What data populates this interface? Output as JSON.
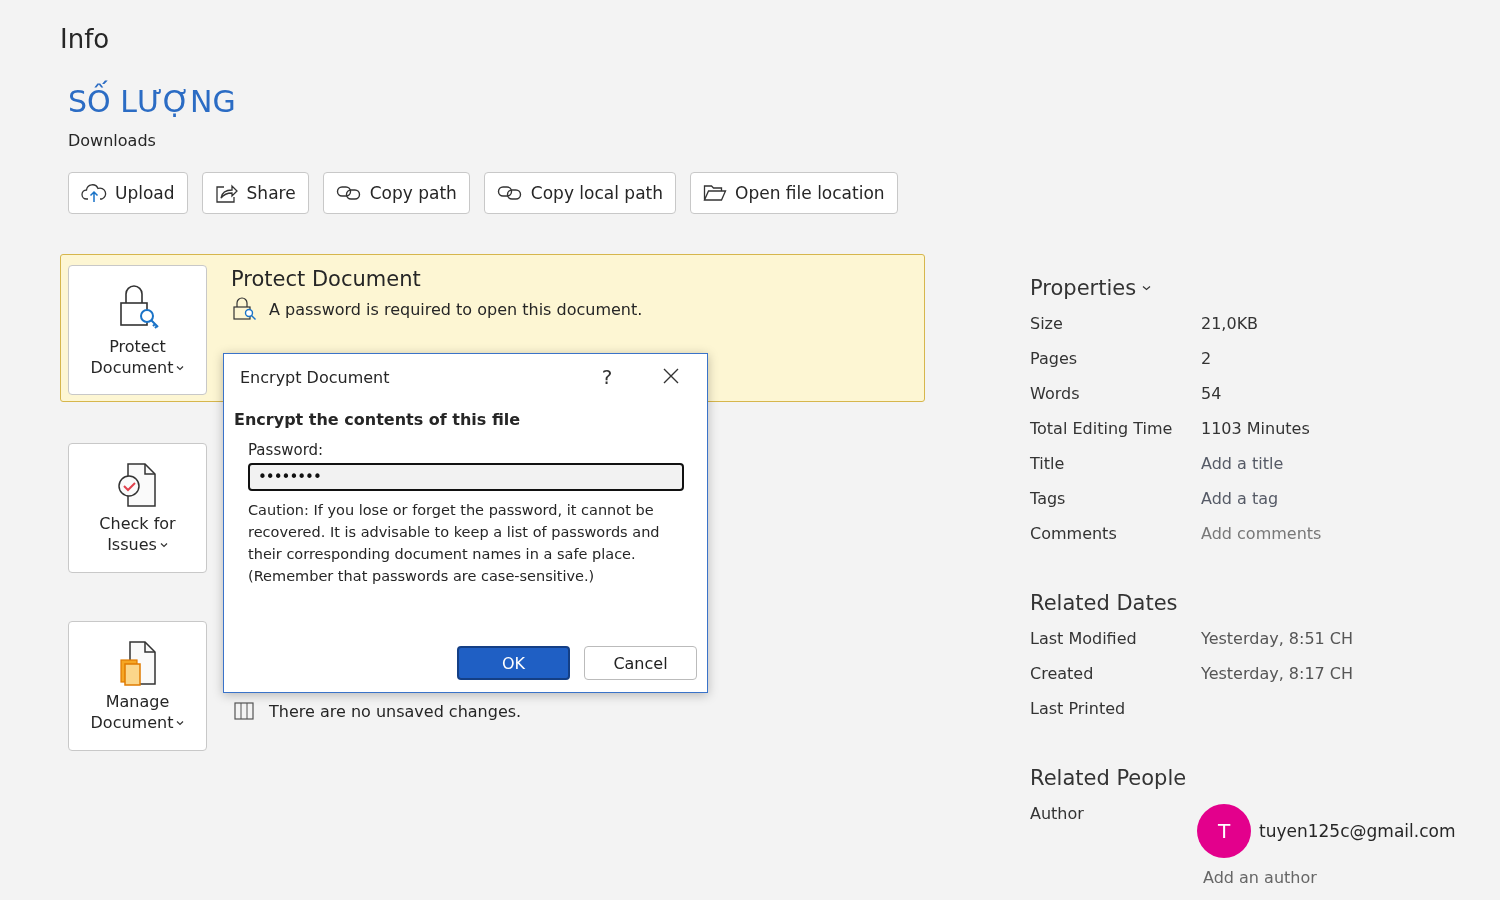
{
  "page": {
    "title": "Info"
  },
  "document": {
    "name": "SỐ LƯỢNG",
    "location": "Downloads"
  },
  "actions": [
    {
      "label": "Upload",
      "kind": "upload"
    },
    {
      "label": "Share",
      "kind": "share"
    },
    {
      "label": "Copy path",
      "kind": "link"
    },
    {
      "label": "Copy local path",
      "kind": "link"
    },
    {
      "label": "Open file location",
      "kind": "folder"
    }
  ],
  "sections": [
    {
      "kind": "protect",
      "highlighted": true,
      "button_lines": [
        "Protect",
        "Document"
      ],
      "title": "Protect Document",
      "details": [
        "A password is required to open this document."
      ]
    },
    {
      "kind": "check",
      "highlighted": false,
      "button_lines": [
        "Check for",
        "Issues"
      ]
    },
    {
      "kind": "manage",
      "highlighted": false,
      "button_lines": [
        "Manage",
        "Document"
      ],
      "details": [
        "There are no unsaved changes."
      ]
    }
  ],
  "dialog": {
    "title": "Encrypt Document",
    "help": "?",
    "heading": "Encrypt the contents of this file",
    "password_label": "Password:",
    "password_value": "••••••••",
    "caution": "Caution: If you lose or forget the password, it cannot be recovered. It is advisable to keep a list of passwords and their corresponding document names in a safe place.",
    "reminder": "(Remember that passwords are case-sensitive.)",
    "buttons": [
      {
        "label": "OK",
        "default": true
      },
      {
        "label": "Cancel",
        "default": false
      }
    ]
  },
  "properties": {
    "title": "Properties",
    "items": [
      {
        "label": "Size",
        "value": "21,0KB",
        "kind": "value"
      },
      {
        "label": "Pages",
        "value": "2",
        "kind": "value"
      },
      {
        "label": "Words",
        "value": "54",
        "kind": "value"
      },
      {
        "label": "Total Editing Time",
        "value": "1103 Minutes",
        "kind": "value"
      },
      {
        "label": "Title",
        "value": "Add a title",
        "kind": "editable"
      },
      {
        "label": "Tags",
        "value": "Add a tag",
        "kind": "editable"
      },
      {
        "label": "Comments",
        "placeholder": "Add comments",
        "kind": "placeholder"
      }
    ]
  },
  "related_dates": {
    "title": "Related Dates",
    "items": [
      {
        "label": "Last Modified",
        "value": "Yesterday, 8:51 CH"
      },
      {
        "label": "Created",
        "value": "Yesterday, 8:17 CH"
      },
      {
        "label": "Last Printed"
      }
    ]
  },
  "related_people": {
    "title": "Related People",
    "author_label": "Author",
    "author": {
      "initial": "T",
      "name": "tuyen125c@gmail.com",
      "color": "#e3008c"
    },
    "add_author": "Add an author"
  }
}
